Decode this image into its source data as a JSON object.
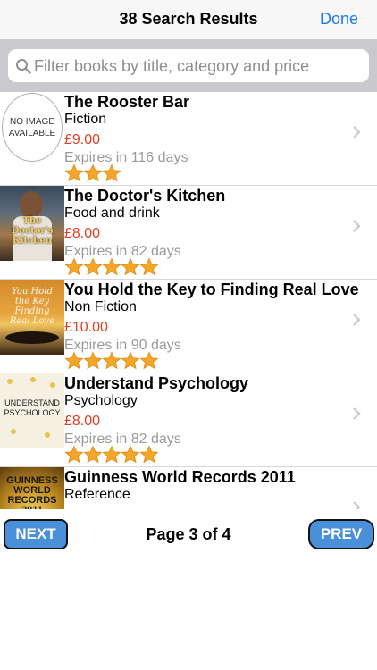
{
  "navbar": {
    "title": "38 Search Results",
    "done_label": "Done"
  },
  "search": {
    "placeholder": "Filter books by title, category and price",
    "icon": "search-icon"
  },
  "colors": {
    "accent": "#1a7bf2",
    "price": "#dd3f26",
    "button": "#4a90d9",
    "star": "#f4a62a"
  },
  "results": [
    {
      "title": "The Rooster Bar",
      "category": "Fiction",
      "price": "£9.00",
      "expiry": "Expires in 116 days",
      "rating": 3,
      "cover": {
        "type": "none",
        "text": "NO IMAGE AVAILABLE"
      }
    },
    {
      "title": "The Doctor's Kitchen",
      "category": "Food and drink",
      "price": "£8.00",
      "expiry": "Expires in 82 days",
      "rating": 5,
      "cover": {
        "type": "image",
        "text": "The Doctor's Kitchen"
      }
    },
    {
      "title": "You Hold the Key to Finding Real Love",
      "category": "Non Fiction",
      "price": "£10.00",
      "expiry": "Expires in 90 days",
      "rating": 5,
      "cover": {
        "type": "image",
        "text": "You Hold the Key Finding Real Love"
      }
    },
    {
      "title": "Understand Psychology",
      "category": "Psychology",
      "price": "£8.00",
      "expiry": "Expires in 82 days",
      "rating": 5,
      "cover": {
        "type": "image",
        "text": "UNDERSTAND PSYCHOLOGY"
      }
    },
    {
      "title": "Guinness World Records 2011",
      "category": "Reference",
      "price": "",
      "expiry": "",
      "rating": 0,
      "cover": {
        "type": "image",
        "text": "GUINNESS WORLD RECORDS 2011"
      }
    }
  ],
  "pagination": {
    "next_label": "NEXT",
    "prev_label": "PREV",
    "page_text": "Page 3 of 4"
  }
}
